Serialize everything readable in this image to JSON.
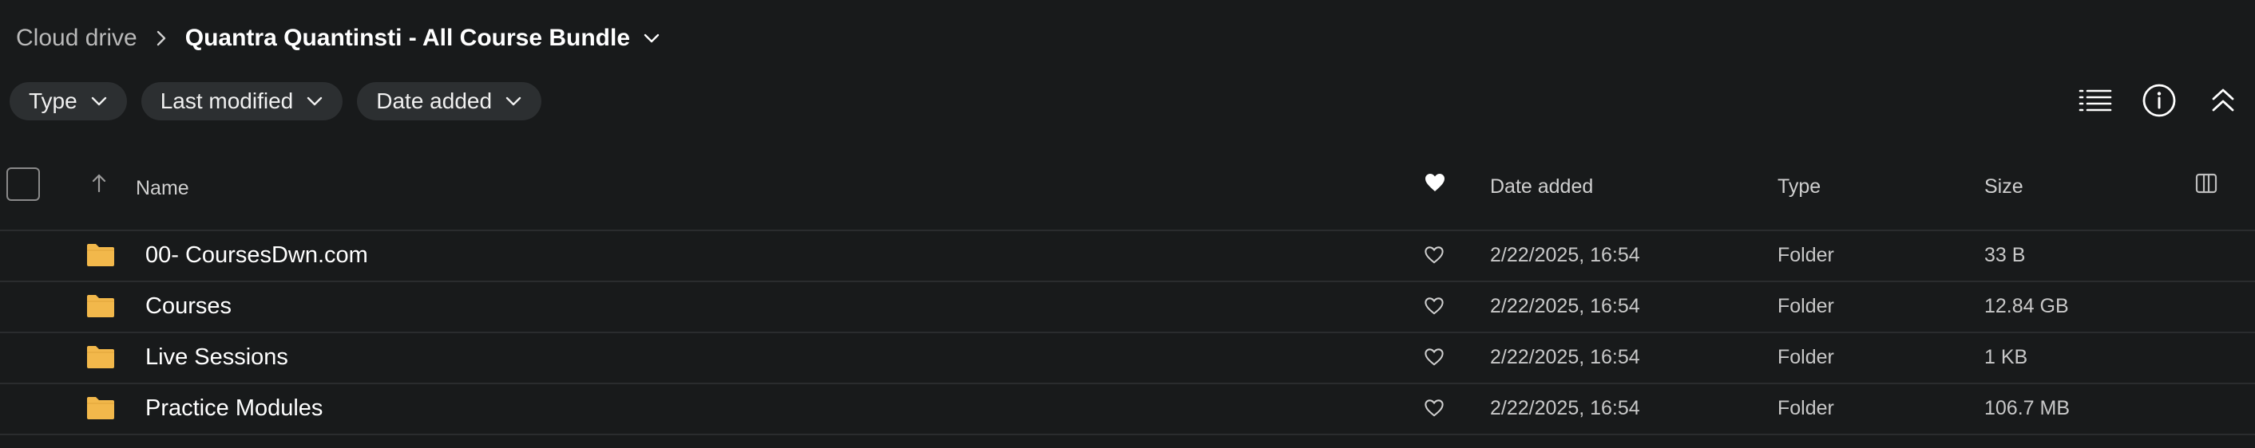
{
  "breadcrumb": {
    "root": "Cloud drive",
    "current": "Quantra Quantinsti - All Course Bundle"
  },
  "filters": [
    {
      "label": "Type"
    },
    {
      "label": "Last modified"
    },
    {
      "label": "Date added"
    }
  ],
  "toolbar": {
    "icons": [
      "list-view-icon",
      "info-icon",
      "collapse-icon"
    ]
  },
  "table": {
    "columns": {
      "name": "Name",
      "date_added": "Date added",
      "type": "Type",
      "size": "Size"
    },
    "rows": [
      {
        "name": "00- CoursesDwn.com",
        "date_added": "2/22/2025, 16:54",
        "type": "Folder",
        "size": "33 B"
      },
      {
        "name": "Courses",
        "date_added": "2/22/2025, 16:54",
        "type": "Folder",
        "size": "12.84 GB"
      },
      {
        "name": "Live Sessions",
        "date_added": "2/22/2025, 16:54",
        "type": "Folder",
        "size": "1 KB"
      },
      {
        "name": "Practice Modules",
        "date_added": "2/22/2025, 16:54",
        "type": "Folder",
        "size": "106.7 MB"
      }
    ]
  },
  "colors": {
    "background": "#181a1b",
    "chip": "#2c2f31",
    "folder": "#f2b84b",
    "divider": "#2a2c2e"
  }
}
